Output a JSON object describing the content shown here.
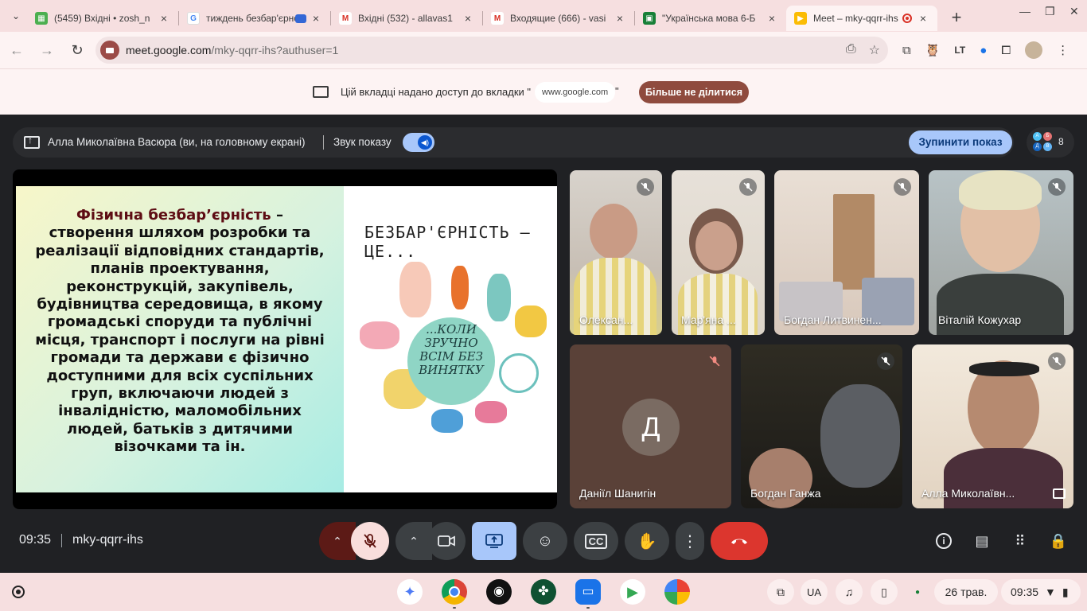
{
  "tabs": [
    {
      "title": "(5459) Вхідні • zosh_n",
      "fav_color": "#4caf50",
      "fav_glyph": "▦"
    },
    {
      "title": "тиждень безбар'єрно",
      "fav_color": "#4285f4",
      "fav_glyph": "G"
    },
    {
      "title": "Вхідні (532) - allavas1",
      "fav_color": "#d93025",
      "fav_glyph": "M"
    },
    {
      "title": "Входящие (666) - vasi",
      "fav_color": "#d93025",
      "fav_glyph": "M"
    },
    {
      "title": "\"Українська мова 6-Б",
      "fav_color": "#188038",
      "fav_glyph": "▣"
    },
    {
      "title": "Meet – mky-qqrr-ihs",
      "fav_color": "#fbbc04",
      "fav_glyph": "▶"
    }
  ],
  "address": {
    "host": "meet.google.com",
    "path": "/mky-qqrr-ihs?authuser=1"
  },
  "sharing_banner": {
    "text": "Цій вкладці надано доступ до вкладки \"",
    "chip": "www.google.com",
    "close_quote": "\"",
    "stop_label": "Більше не ділитися"
  },
  "presentation": {
    "presenter": "Алла Миколаївна Васюра (ви, на головному екрані)",
    "sound_label": "Звук показу",
    "stop_label": "Зупинити показ",
    "participant_count": "8"
  },
  "slide": {
    "term": "Фізична безбар’єрність",
    "dash": " –",
    "lines": [
      "створення шляхом розробки та",
      "реалізації відповідних стандартів,",
      "планів проектування,",
      "реконструкцій, закупівель,",
      "будівництва середовища, в якому",
      "громадські споруди та публічні",
      "місця, транспорт і послуги на рівні",
      "громади та держави є фізично",
      "доступними для всіх суспільних",
      "груп, включаючи людей з",
      "інвалідністю, маломобільних",
      "людей, батьків з дитячими",
      "візочками та ін."
    ],
    "poster_title": "БЕЗБАР'ЄРНІСТЬ — ЦЕ...",
    "poster_circle": [
      "...КОЛИ",
      "ЗРУЧНО",
      "ВСІМ БЕЗ",
      "ВИНЯТКУ"
    ]
  },
  "participants": [
    {
      "name": "Олексан...",
      "muted": true
    },
    {
      "name": "Мар'яна ...",
      "muted": true
    },
    {
      "name": "Богдан Литвинен...",
      "muted": true
    },
    {
      "name": "Віталій Кожухар",
      "muted": true
    },
    {
      "name": "Даніїл Шанигін",
      "initial": "Д",
      "muted": true
    },
    {
      "name": "Богдан Ганжа",
      "muted": true
    },
    {
      "name": "Алла Миколаївн...",
      "muted": true
    }
  ],
  "meeting": {
    "time": "09:35",
    "code": "mky-qqrr-ihs"
  },
  "shelf": {
    "lang": "UA",
    "date": "26 трав.",
    "time": "09:35"
  },
  "colors": {
    "accent": "#a8c7fa",
    "hangup": "#dc362e",
    "mic_off": "#f9dedc",
    "stop_share": "#8f4b3e"
  }
}
